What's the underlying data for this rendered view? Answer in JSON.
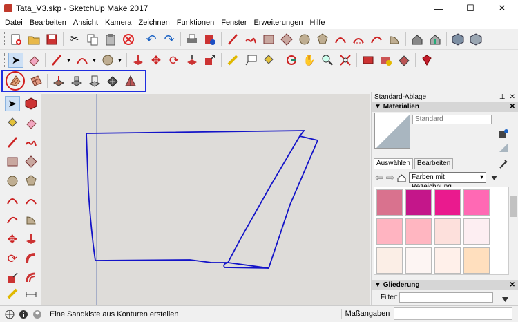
{
  "window": {
    "title": "Tata_V3.skp - SketchUp Make 2017",
    "minimize": "—",
    "maximize": "☐",
    "close": "✕"
  },
  "menu": [
    "Datei",
    "Bearbeiten",
    "Ansicht",
    "Kamera",
    "Zeichnen",
    "Funktionen",
    "Fenster",
    "Erweiterungen",
    "Hilfe"
  ],
  "panel": {
    "title": "Standard-Ablage",
    "pin": "⊥",
    "close": "✕",
    "materials": {
      "header": "Materialien",
      "name": "Standard",
      "tab_select": "Auswählen",
      "tab_edit": "Bearbeiten",
      "library": "Farben mit Bezeichnung"
    },
    "outliner": {
      "header": "Gliederung",
      "filter_label": "Filter:"
    }
  },
  "status": {
    "text": "Eine Sandkiste aus Konturen erstellen",
    "measurements_label": "Maßangaben"
  },
  "swatches": [
    "#d9728e",
    "#c4168a",
    "#ea1a8e",
    "#ff69b4",
    "#ffb4c1",
    "#ffb6c1",
    "#fde0dc",
    "#fdeef2",
    "#fbeee6",
    "#fdf5f3",
    "#fff0ea",
    "#ffdfbe"
  ],
  "colors": {
    "selection_outline": "#1f2ee0",
    "highlight_ring": "#d21f1f",
    "shape_stroke": "#1313c8"
  }
}
